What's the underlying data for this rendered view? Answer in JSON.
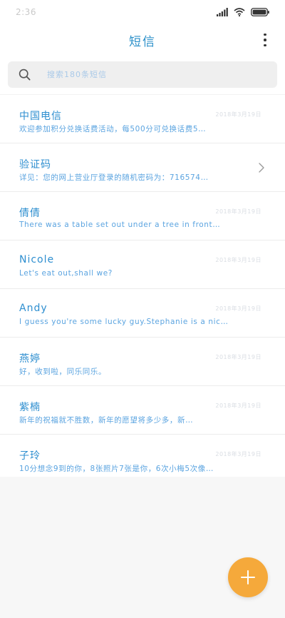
{
  "status_bar": {
    "time": "2:36",
    "signal_icon": "signal-icon",
    "wifi_icon": "wifi-icon",
    "battery_icon": "battery-icon"
  },
  "header": {
    "title": "短信",
    "more_icon": "more-vertical-icon"
  },
  "search": {
    "placeholder": "搜索180条短信"
  },
  "messages": [
    {
      "name": "中国电信",
      "preview": "欢迎参加积分兑换话费活动，每500分可兑换话费5…",
      "date": "2018年3月19日",
      "has_chevron": false
    },
    {
      "name": "验证码",
      "preview": "详见：您的网上营业厅登录的随机密码为：716574…",
      "date": "",
      "has_chevron": true
    },
    {
      "name": "倩倩",
      "preview": "There was a table set out under a tree in front…",
      "date": "2018年3月19日",
      "has_chevron": false
    },
    {
      "name": "Nicole",
      "preview": "Let's eat out,shall we?",
      "date": "2018年3月19日",
      "has_chevron": false
    },
    {
      "name": "Andy",
      "preview": "I guess you're some lucky guy.Stephanie is a nic…",
      "date": "2018年3月19日",
      "has_chevron": false
    },
    {
      "name": "燕婷",
      "preview": "好，收到啦，同乐同乐。",
      "date": "2018年3月19日",
      "has_chevron": false
    },
    {
      "name": "紫楠",
      "preview": "新年的祝福就不胜数，新年的愿望将多少多，新…",
      "date": "2018年3月19日",
      "has_chevron": false
    },
    {
      "name": "子玲",
      "preview": "10分想念9到的你，8张照片7张是你，6次小梅5次像…",
      "date": "2018年3月19日",
      "has_chevron": false
    }
  ],
  "fab": {
    "icon": "plus-icon"
  },
  "colors": {
    "accent": "#2f8fd0",
    "fab": "#f5a93b"
  }
}
